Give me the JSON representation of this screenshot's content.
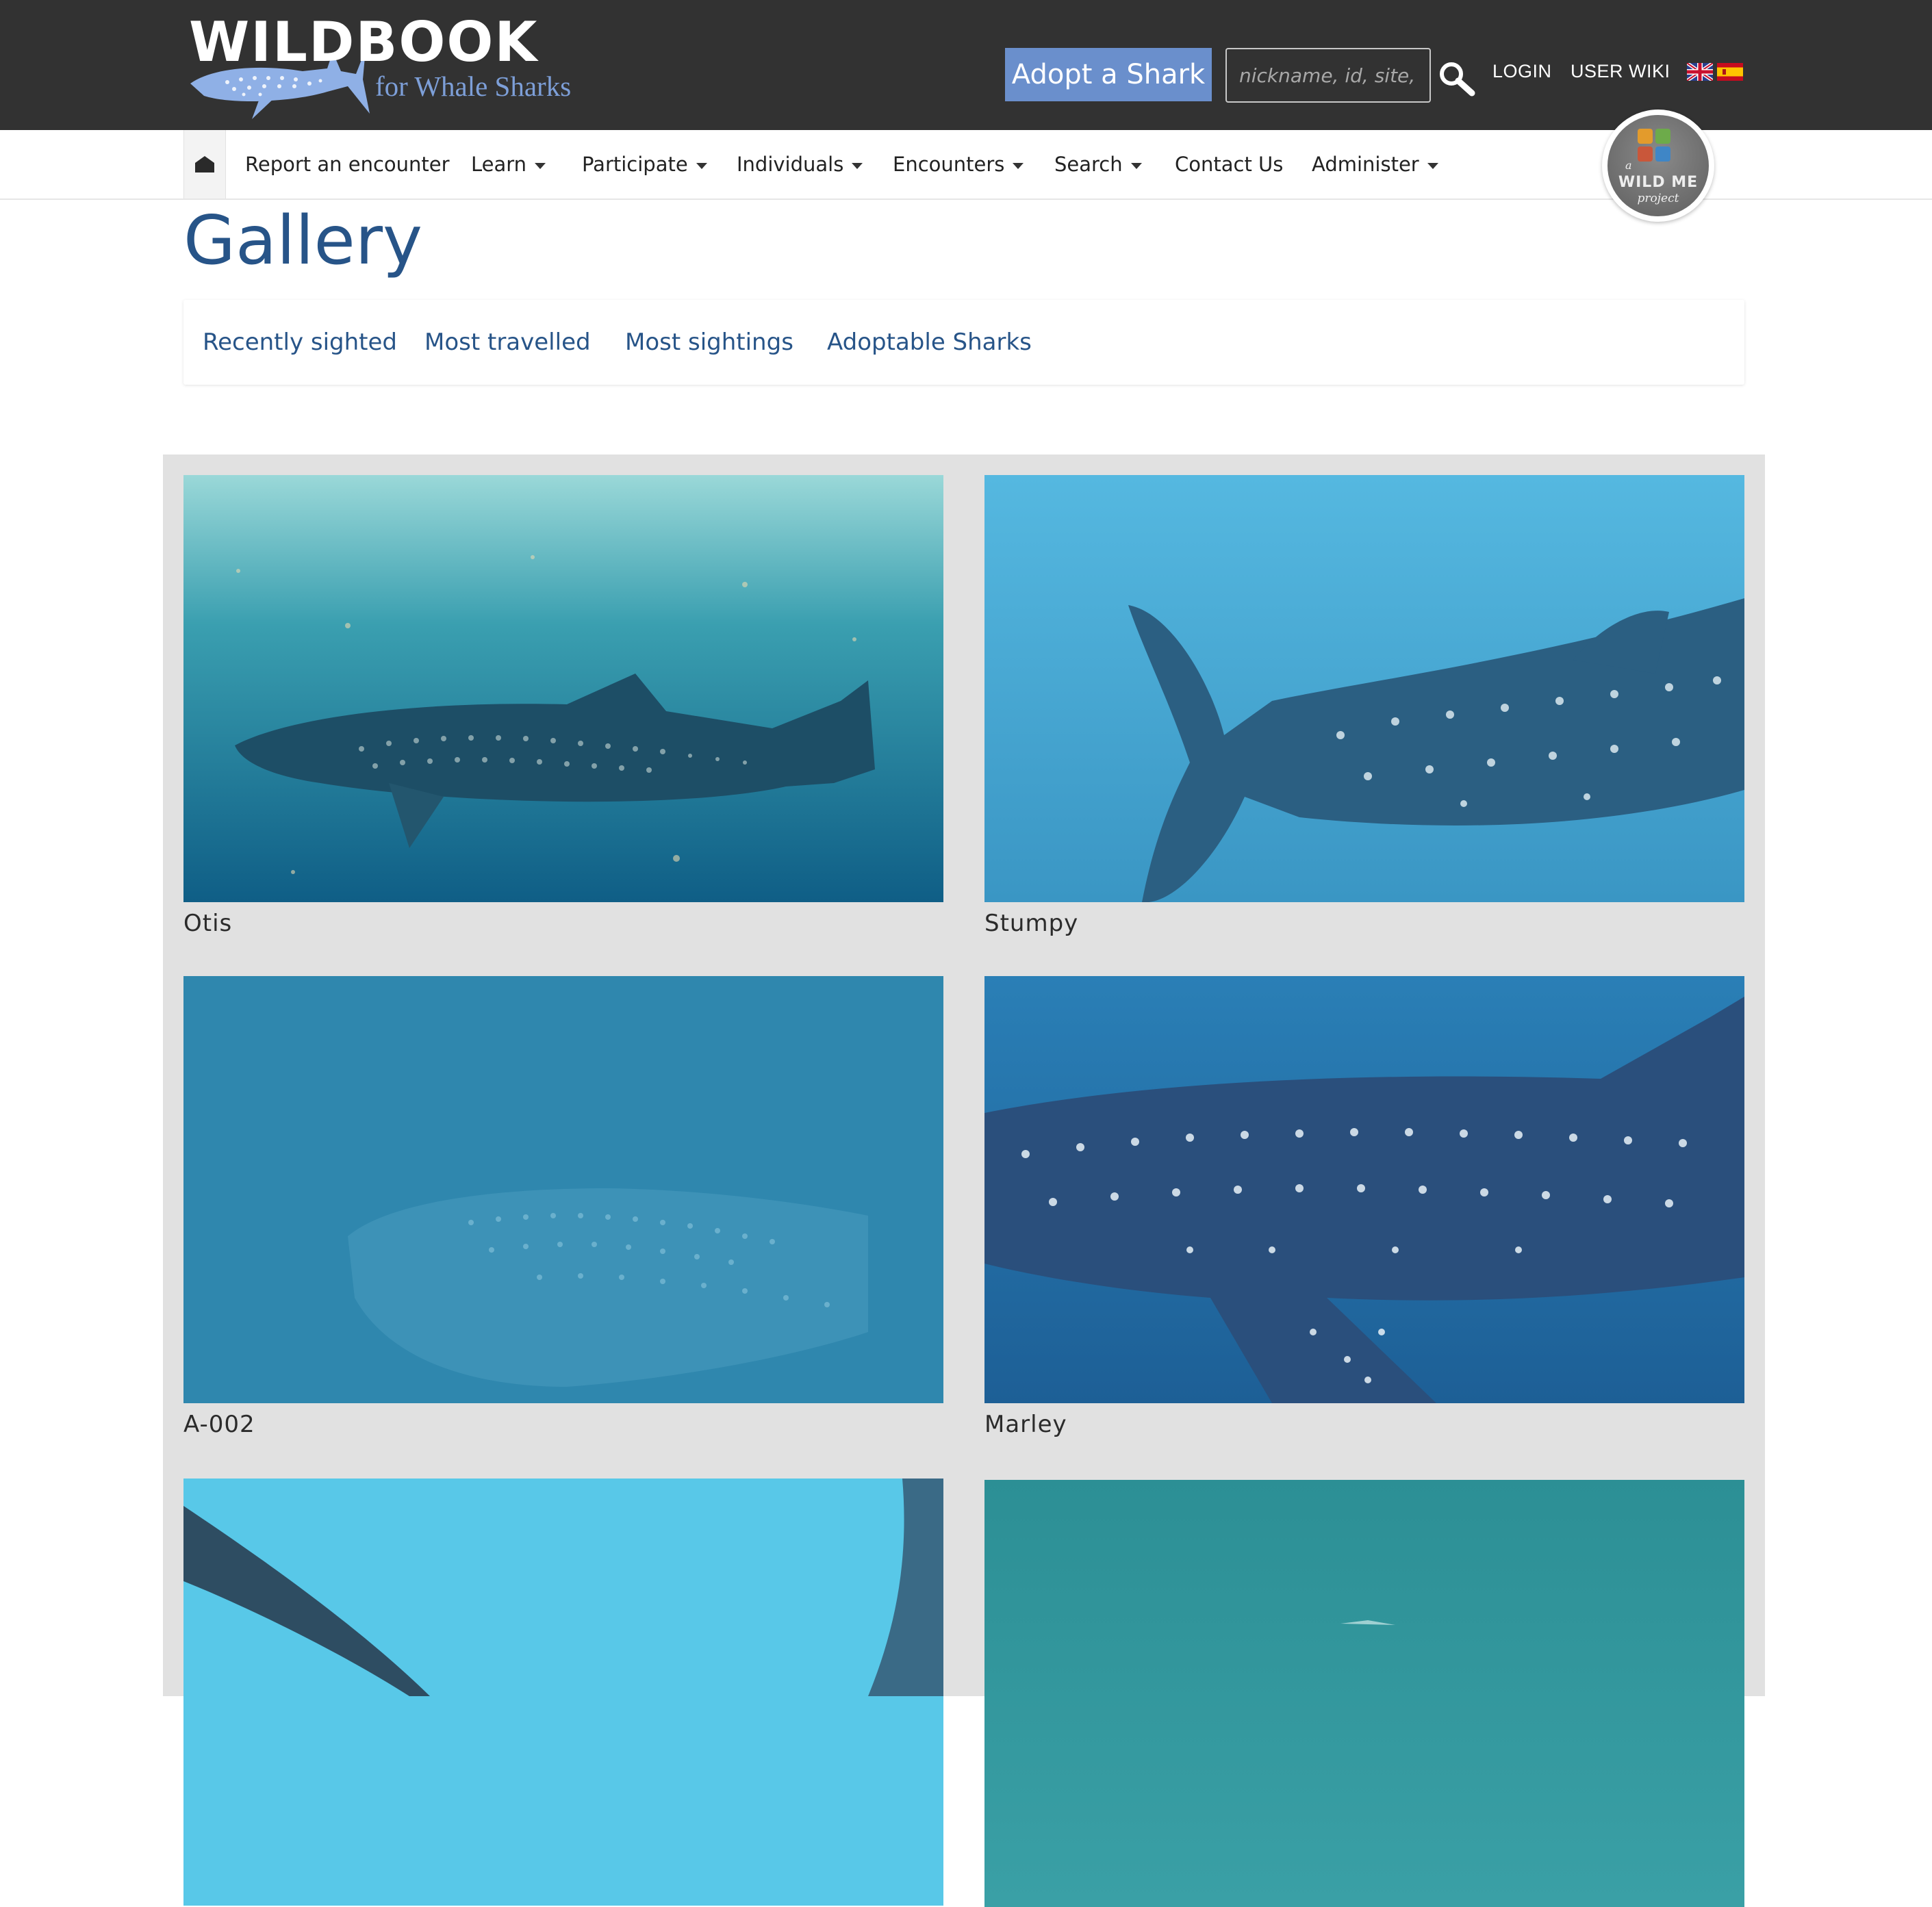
{
  "header": {
    "brand_title": "WILDBOOK",
    "brand_subtitle": "for Whale Sharks",
    "adopt_button": "Adopt a Shark",
    "search_placeholder": "nickname, id, site, e",
    "login_link": "LOGIN",
    "wiki_link": "USER WIKI",
    "languages": [
      "english-flag-icon",
      "spanish-flag-icon"
    ]
  },
  "nav": {
    "items": [
      {
        "label": "Report an encounter",
        "dropdown": false
      },
      {
        "label": "Learn",
        "dropdown": true
      },
      {
        "label": "Participate",
        "dropdown": true
      },
      {
        "label": "Individuals",
        "dropdown": true
      },
      {
        "label": "Encounters",
        "dropdown": true
      },
      {
        "label": "Search",
        "dropdown": true
      },
      {
        "label": "Contact Us",
        "dropdown": false
      },
      {
        "label": "Administer",
        "dropdown": true
      }
    ],
    "badge_prefix": "a",
    "badge_text": "WILD ME",
    "badge_script": "project"
  },
  "page": {
    "title": "Gallery",
    "tabs": [
      "Recently sighted",
      "Most travelled",
      "Most sightings",
      "Adoptable Sharks"
    ]
  },
  "gallery": {
    "cards": [
      {
        "name": "Otis"
      },
      {
        "name": "Stumpy"
      },
      {
        "name": "A-002"
      },
      {
        "name": "Marley"
      },
      {
        "name": ""
      },
      {
        "name": ""
      }
    ]
  },
  "colors": {
    "header_bg": "#323232",
    "accent": "#6a8fcc",
    "title_blue": "#275488",
    "panel_bg": "#e1e1e1"
  }
}
